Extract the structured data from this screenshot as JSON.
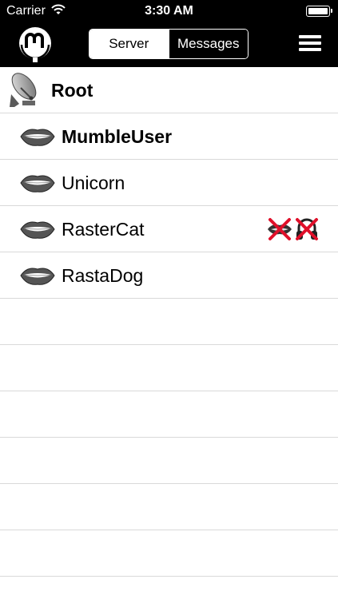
{
  "status_bar": {
    "carrier": "Carrier",
    "time": "3:30 AM"
  },
  "nav": {
    "tabs": [
      {
        "label": "Server",
        "selected": true
      },
      {
        "label": "Messages",
        "selected": false
      }
    ]
  },
  "channel_tree": {
    "root_channel": {
      "name": "Root",
      "icon": "satellite-dish-icon"
    },
    "users": [
      {
        "name": "MumbleUser",
        "icon": "talking-lips-icon",
        "is_self": true,
        "status_icons": []
      },
      {
        "name": "Unicorn",
        "icon": "talking-lips-icon",
        "is_self": false,
        "status_icons": []
      },
      {
        "name": "RasterCat",
        "icon": "talking-lips-icon",
        "is_self": false,
        "status_icons": [
          "muted-icon",
          "deafened-icon"
        ]
      },
      {
        "name": "RastaDog",
        "icon": "talking-lips-icon",
        "is_self": false,
        "status_icons": []
      }
    ],
    "empty_rows": 6
  },
  "colors": {
    "header_bg": "#000000",
    "separator": "#d9d9d9",
    "status_cross": "#e0102a"
  }
}
